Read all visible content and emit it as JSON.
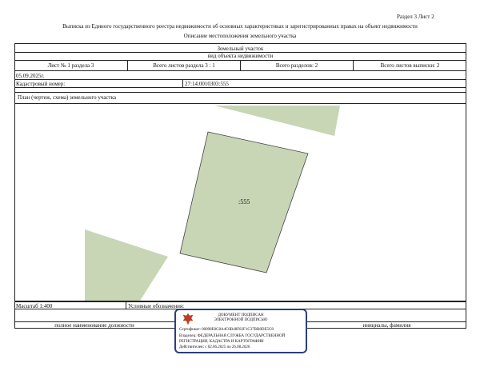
{
  "header": {
    "section_sheet": "Раздел 3   Лист 2",
    "title": "Выписка из Единого государственного реестра недвижимости об основных характеристиках и зарегистрированных правах на объект недвижимости",
    "subtitle": "Описание местоположения земельного участка"
  },
  "object": {
    "type": "Земельный участок",
    "type_caption": "вид объекта недвижимости"
  },
  "info_row": {
    "sheet_no": "Лист № 1 раздела 3",
    "total_sheets_section": "Всего листов раздела 3 : 1",
    "total_sections": "Всего разделов: 2",
    "total_sheets_extract": "Всего листов выписки: 2"
  },
  "date": "05.09.2025г.",
  "cadastral": {
    "label": "Кадастровый номер:",
    "value": "27:14:0010303:555"
  },
  "plan": {
    "caption": "План (чертеж, схема) земельного участка",
    "parcel_label": ":555"
  },
  "footer": {
    "scale": "Масштаб 1:400",
    "legend_label": "Условные обозначения:",
    "position_caption": "полное наименование должности",
    "name_caption": "инициалы, фамилия"
  },
  "stamp": {
    "line1": "ДОКУМЕНТ ПОДПИСАН",
    "line2": "ЭЛЕКТРОННОЙ ПОДПИСЬЮ",
    "cert": "Сертификат: 00098E0C8A4C0B48F02F1C37BB8DE5C8",
    "owner_line1": "Владелец: ФЕДЕРАЛЬНАЯ СЛУЖБА ГОСУДАРСТВЕННОЙ",
    "owner_line2": "РЕГИСТРАЦИИ, КАДАСТРА И КАРТОГРАФИИ",
    "valid": "Действителен: с 02.06.2025 по 26.08.2026"
  },
  "colors": {
    "parcel_fill": "#c8d6b6",
    "parcel_stroke": "#444444",
    "stamp_border": "#2b3f7a",
    "emblem": "#c0392b"
  }
}
